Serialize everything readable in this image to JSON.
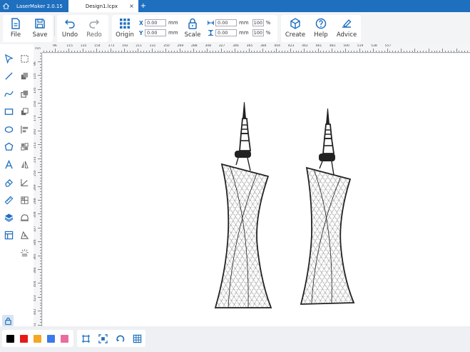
{
  "titlebar": {
    "app_title": "LaserMaker 2.0.15",
    "document_tab": "Design1.lcpx",
    "close_glyph": "×",
    "add_glyph": "+"
  },
  "toolbar": {
    "file": "File",
    "save": "Save",
    "undo": "Undo",
    "redo": "Redo",
    "origin": "Origin",
    "scale": "Scale",
    "create": "Create",
    "help": "Help",
    "advice": "Advice",
    "x_label": "X",
    "y_label": "Y",
    "x_value": "0.00",
    "y_value": "0.00",
    "width_value": "0.00",
    "height_value": "0.00",
    "width_pct": "100",
    "height_pct": "100",
    "unit": "mm",
    "pct_unit": "%"
  },
  "ruler": {
    "corner": "mm",
    "top_labels": [
      "96",
      "115",
      "135",
      "154",
      "173",
      "192",
      "211",
      "231",
      "250",
      "269",
      "288",
      "308",
      "327",
      "346",
      "365",
      "384",
      "404",
      "423",
      "442",
      "461",
      "481",
      "500",
      "519",
      "538",
      "557"
    ],
    "left_labels": [
      "96",
      "115",
      "135",
      "154",
      "173",
      "192",
      "211",
      "231",
      "250",
      "269",
      "288",
      "308",
      "327",
      "346",
      "365",
      "384",
      "404",
      "423",
      "442",
      "461"
    ]
  },
  "palette_icons": {
    "left": [
      "select-arrow-icon",
      "line-icon",
      "curve-icon",
      "rectangle-icon",
      "ellipse-icon",
      "polygon-icon",
      "text-icon",
      "eraser-icon",
      "measure-ruler-icon",
      "layers-icon",
      "layout-icon"
    ],
    "right": [
      "marquee-select-icon",
      "combine-shapes-icon",
      "weld-icon",
      "subtract-icon",
      "align-icon",
      "arrange-icon",
      "mirror-icon",
      "angle-icon",
      "grid-array-icon",
      "trace-image-icon",
      "offset-icon",
      "laser-burst-icon"
    ]
  },
  "swatches": [
    "#000000",
    "#e8191b",
    "#f5a623",
    "#3a7be8",
    "#e86ea0"
  ],
  "accent": "#1f6fbf"
}
